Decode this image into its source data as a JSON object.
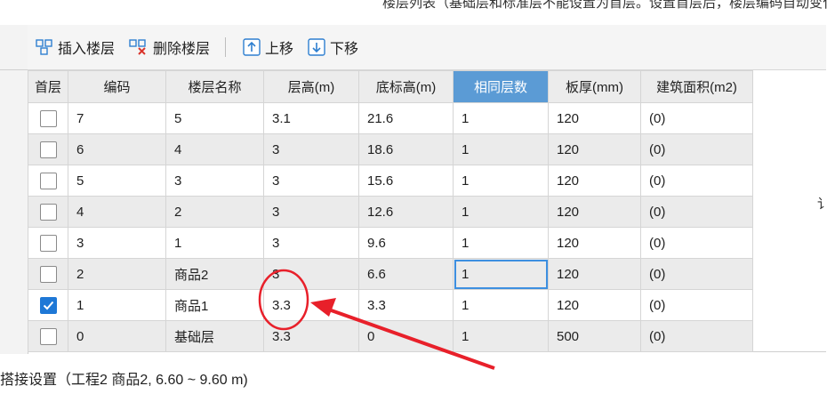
{
  "top_note": "楼层列表（基础层和标准层不能设置为首层。设置首层后，楼层编码自动变化，正数为地上层，负数为地",
  "toolbar": {
    "insert_label": "插入楼层",
    "delete_label": "删除楼层",
    "up_label": "上移",
    "down_label": "下移"
  },
  "table": {
    "columns": [
      "首层",
      "编码",
      "楼层名称",
      "层高(m)",
      "底标高(m)",
      "相同层数",
      "板厚(mm)",
      "建筑面积(m2)"
    ],
    "highlighted_column": "相同层数",
    "rows": [
      {
        "first": false,
        "code": "7",
        "name": "5",
        "height": "3.1",
        "bottom": "21.6",
        "same": "1",
        "slab": "120",
        "area": "(0)"
      },
      {
        "first": false,
        "code": "6",
        "name": "4",
        "height": "3",
        "bottom": "18.6",
        "same": "1",
        "slab": "120",
        "area": "(0)"
      },
      {
        "first": false,
        "code": "5",
        "name": "3",
        "height": "3",
        "bottom": "15.6",
        "same": "1",
        "slab": "120",
        "area": "(0)"
      },
      {
        "first": false,
        "code": "4",
        "name": "2",
        "height": "3",
        "bottom": "12.6",
        "same": "1",
        "slab": "120",
        "area": "(0)"
      },
      {
        "first": false,
        "code": "3",
        "name": "1",
        "height": "3",
        "bottom": "9.6",
        "same": "1",
        "slab": "120",
        "area": "(0)"
      },
      {
        "first": false,
        "code": "2",
        "name": "商品2",
        "height": "3",
        "bottom": "6.6",
        "same": "1",
        "slab": "120",
        "area": "(0)"
      },
      {
        "first": true,
        "code": "1",
        "name": "商品1",
        "height": "3.3",
        "bottom": "3.3",
        "same": "1",
        "slab": "120",
        "area": "(0)"
      },
      {
        "first": false,
        "code": "0",
        "name": "基础层",
        "height": "3.3",
        "bottom": "0",
        "same": "1",
        "slab": "500",
        "area": "(0)"
      }
    ]
  },
  "status": "搭接设置（工程2  商品2, 6.60 ~ 9.60 m)",
  "right_clip": "讠",
  "colors": {
    "accent": "#1e78d6",
    "header_highlight": "#5b9bd5",
    "annotation": "#e8202a"
  }
}
